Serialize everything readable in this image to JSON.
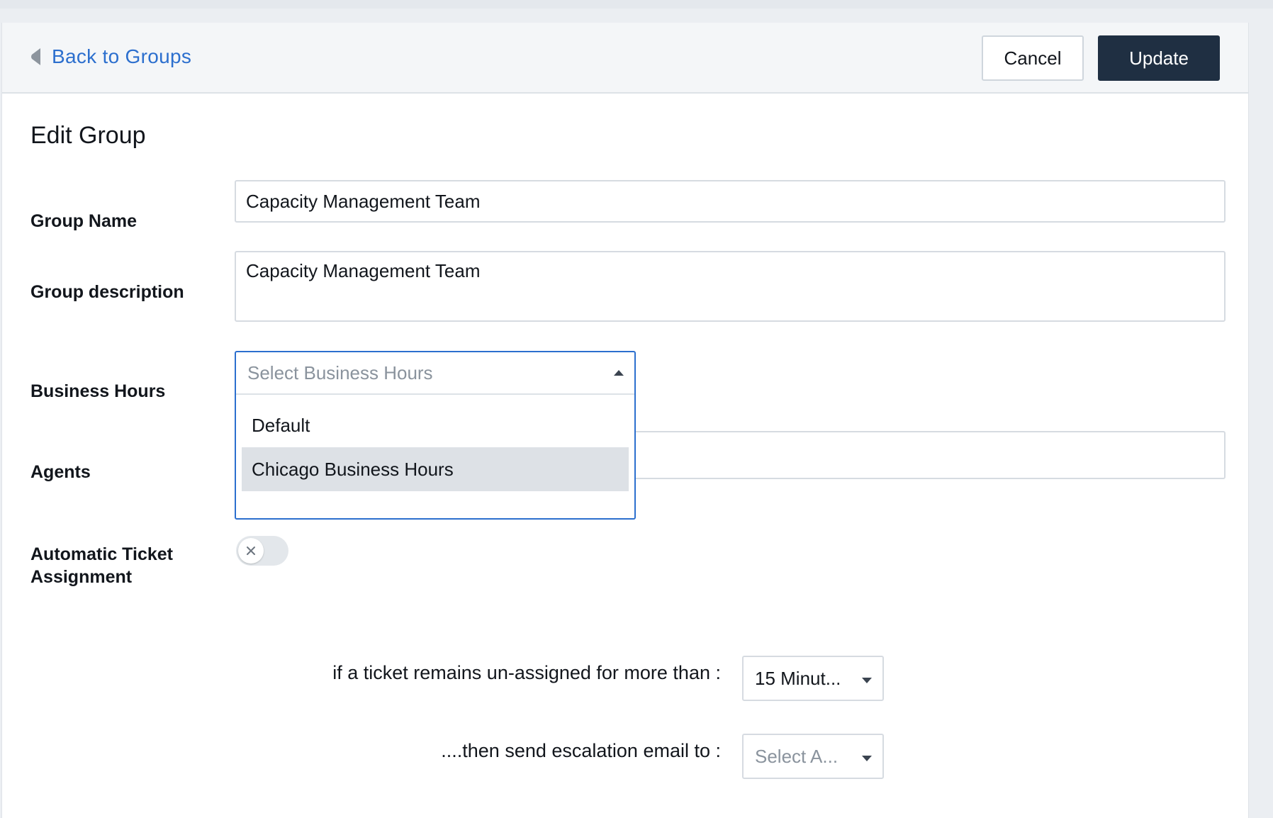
{
  "header": {
    "back_label": "Back to Groups",
    "cancel_label": "Cancel",
    "update_label": "Update"
  },
  "page": {
    "title": "Edit Group"
  },
  "form": {
    "group_name_label": "Group Name",
    "group_name_value": "Capacity Management Team",
    "group_description_label": "Group description",
    "group_description_value": "Capacity Management Team",
    "business_hours_label": "Business Hours",
    "business_hours_placeholder": "Select Business Hours",
    "business_hours_options": [
      "Default",
      "Chicago Business Hours"
    ],
    "business_hours_highlighted": "Chicago Business Hours",
    "agents_label": "Agents",
    "auto_assign_label_line1": "Automatic Ticket",
    "auto_assign_label_line2": "Assignment",
    "auto_assign_enabled": false
  },
  "escalation": {
    "unassigned_text": "if a ticket remains un-assigned for more than :",
    "unassigned_value": "15 Minut...",
    "email_text": "....then send escalation email to :",
    "email_placeholder": "Select A..."
  },
  "colors": {
    "link": "#2c6fce",
    "primary_button": "#1f2f42",
    "focus_border": "#2c6fce",
    "highlight_option": "#dde1e6"
  },
  "icons": {
    "back": "triangle-left-icon",
    "dropdown_caret_up": "caret-up-icon",
    "dropdown_caret_down": "caret-down-icon",
    "toggle_off": "close-icon"
  }
}
